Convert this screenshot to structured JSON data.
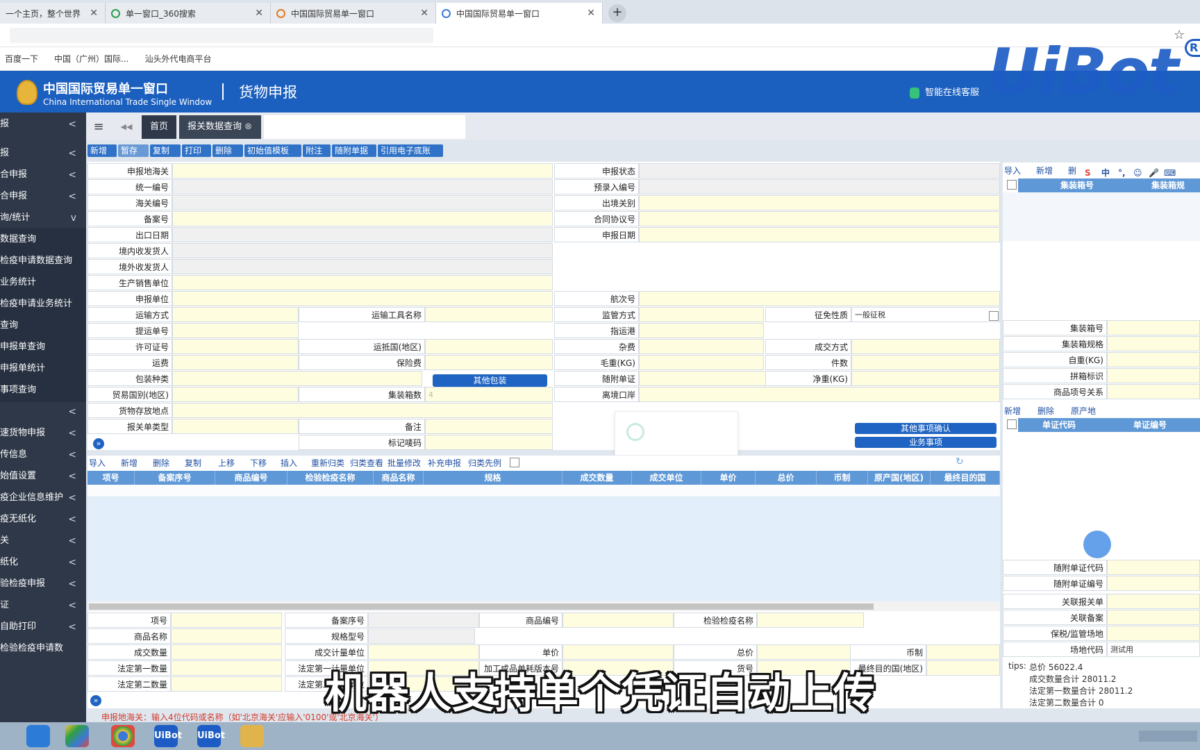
{
  "browser": {
    "tabs": [
      {
        "title": "一个主页，整个世界",
        "active": false
      },
      {
        "title": "单一窗口_360搜索",
        "active": false
      },
      {
        "title": "中国国际贸易单一窗口",
        "active": false
      },
      {
        "title": "中国国际贸易单一窗口",
        "active": true
      }
    ],
    "new_tab": "+",
    "close": "✕",
    "bookmarks": [
      "百度一下",
      "中国（广州）国际...",
      "汕头外代电商平台"
    ],
    "star": "☆"
  },
  "watermark": {
    "brand": "UiBot",
    "tail": "R"
  },
  "header": {
    "site_cn": "中国国际贸易单一窗口",
    "site_en": "China International Trade Single Window",
    "module": "货物申报",
    "service": "智能在线客服"
  },
  "sidebar": {
    "items": [
      {
        "label": "报",
        "chevron": "<"
      },
      {
        "label": "报",
        "chevron": "<"
      },
      {
        "label": "合申报",
        "chevron": "<"
      },
      {
        "label": "合申报",
        "chevron": "<"
      },
      {
        "label": "询/统计",
        "chevron": "v"
      },
      {
        "label": "数据查询",
        "chevron": ""
      },
      {
        "label": "检疫申请数据查询",
        "chevron": ""
      },
      {
        "label": "业务统计",
        "chevron": ""
      },
      {
        "label": "检疫申请业务统计",
        "chevron": ""
      },
      {
        "label": "查询",
        "chevron": ""
      },
      {
        "label": "申报单查询",
        "chevron": ""
      },
      {
        "label": "申报单统计",
        "chevron": ""
      },
      {
        "label": "事项查询",
        "chevron": ""
      },
      {
        "label": "",
        "chevron": "<"
      },
      {
        "label": "速货物申报",
        "chevron": "<"
      },
      {
        "label": "传信息",
        "chevron": "<"
      },
      {
        "label": "始值设置",
        "chevron": "<"
      },
      {
        "label": "疫企业信息维护",
        "chevron": "<"
      },
      {
        "label": "疫无纸化",
        "chevron": "<"
      },
      {
        "label": "关",
        "chevron": "<"
      },
      {
        "label": "纸化",
        "chevron": "<"
      },
      {
        "label": "验检疫申报",
        "chevron": "<"
      },
      {
        "label": "证",
        "chevron": "<"
      },
      {
        "label": "自助打印",
        "chevron": "<"
      },
      {
        "label": "检验检疫申请数",
        "chevron": ""
      }
    ]
  },
  "nav": {
    "menu": "≡",
    "back": "◀◀",
    "home": "首页",
    "tab": "报关数据查询",
    "close": "⊗"
  },
  "toolbar": [
    "新增",
    "暂存",
    "复制",
    "打印",
    "删除",
    "初始值模板",
    "附注",
    "随附单据",
    "引用电子底账"
  ],
  "form": {
    "labels_left": [
      "申报地海关",
      "统一编号",
      "海关编号",
      "备案号",
      "出口日期",
      "境内收发货人",
      "境外收发货人",
      "生产销售单位",
      "申报单位",
      "运输方式",
      "提运单号",
      "许可证号",
      "运费",
      "包装种类",
      "贸易国别(地区)",
      "货物存放地点",
      "报关单类型"
    ],
    "labels_right": [
      "申报状态",
      "预录入编号",
      "出境关别",
      "合同协议号",
      "申报日期",
      "航次号",
      "监管方式",
      "指运港",
      "杂费",
      "毛重(KG)",
      "随附单证",
      "离境口岸"
    ],
    "labels_mid": [
      "运输工具名称",
      "运抵国(地区)",
      "保险费",
      "集装箱数",
      "备注",
      "标记唛码"
    ],
    "labels_far": [
      "征免性质",
      "成交方式",
      "件数",
      "净重(KG)"
    ],
    "zhengmian_value": "一般征税",
    "container_count": "4",
    "other_pack_button": "其他包装",
    "other_confirm_button": "其他事项确认",
    "business_button": "业务事项",
    "expand_icon": "»"
  },
  "grid": {
    "toolbar": [
      "导入",
      "新增",
      "删除",
      "复制",
      "上移",
      "下移",
      "插入",
      "重新归类",
      "归类查看",
      "批量修改",
      "补充申报",
      "归类先例"
    ],
    "refresh": "↻",
    "columns": [
      "项号",
      "备案序号",
      "商品编号",
      "检验检疫名称",
      "商品名称",
      "规格",
      "成交数量",
      "成交单位",
      "单价",
      "总价",
      "币制",
      "原产国(地区)",
      "最终目的国"
    ]
  },
  "detail": {
    "labels": [
      "项号",
      "备案序号",
      "商品编号",
      "检验检疫名称",
      "商品名称",
      "规格型号",
      "成交数量",
      "成交计量单位",
      "单价",
      "总价",
      "币制",
      "法定第一数量",
      "法定第一计量单位",
      "加工成品单耗版本号",
      "货号",
      "最终目的国(地区)",
      "法定第二数量",
      "法定第二计量单位"
    ]
  },
  "right": {
    "container_toolbar": [
      "导入",
      "新增",
      "删"
    ],
    "container_columns": [
      "集装箱号",
      "集装箱规"
    ],
    "container_fields": [
      "集装箱号",
      "集装箱规格",
      "自重(KG)",
      "拼箱标识",
      "商品项号关系"
    ],
    "doc_toolbar": [
      "新增",
      "删除",
      "原产地"
    ],
    "doc_columns": [
      "单证代码",
      "单证编号"
    ],
    "doc_fields": [
      "随附单证代码",
      "随附单证编号"
    ],
    "other_fields": [
      "关联报关单",
      "关联备案",
      "保税/监管场地",
      "场地代码"
    ],
    "site_code_value": "测试用",
    "ime": [
      "S",
      "中",
      "°,",
      "☺",
      "🎤",
      "⌨"
    ],
    "tips": {
      "label": "tips:",
      "lines": [
        "总价 56022.4",
        "成交数量合计 28011.2",
        "法定第一数量合计 28011.2",
        "法定第二数量合计 0"
      ]
    }
  },
  "status_message": "申报地海关：输入4位代码或名称（如'北京海关'应输入'0100'或'北京海关'）",
  "subtitle": "机器人支持单个凭证自动上传",
  "taskbar": {
    "apps": [
      "IE",
      "360",
      "Chrome",
      "UiBot",
      "UiBot",
      "Files"
    ]
  }
}
